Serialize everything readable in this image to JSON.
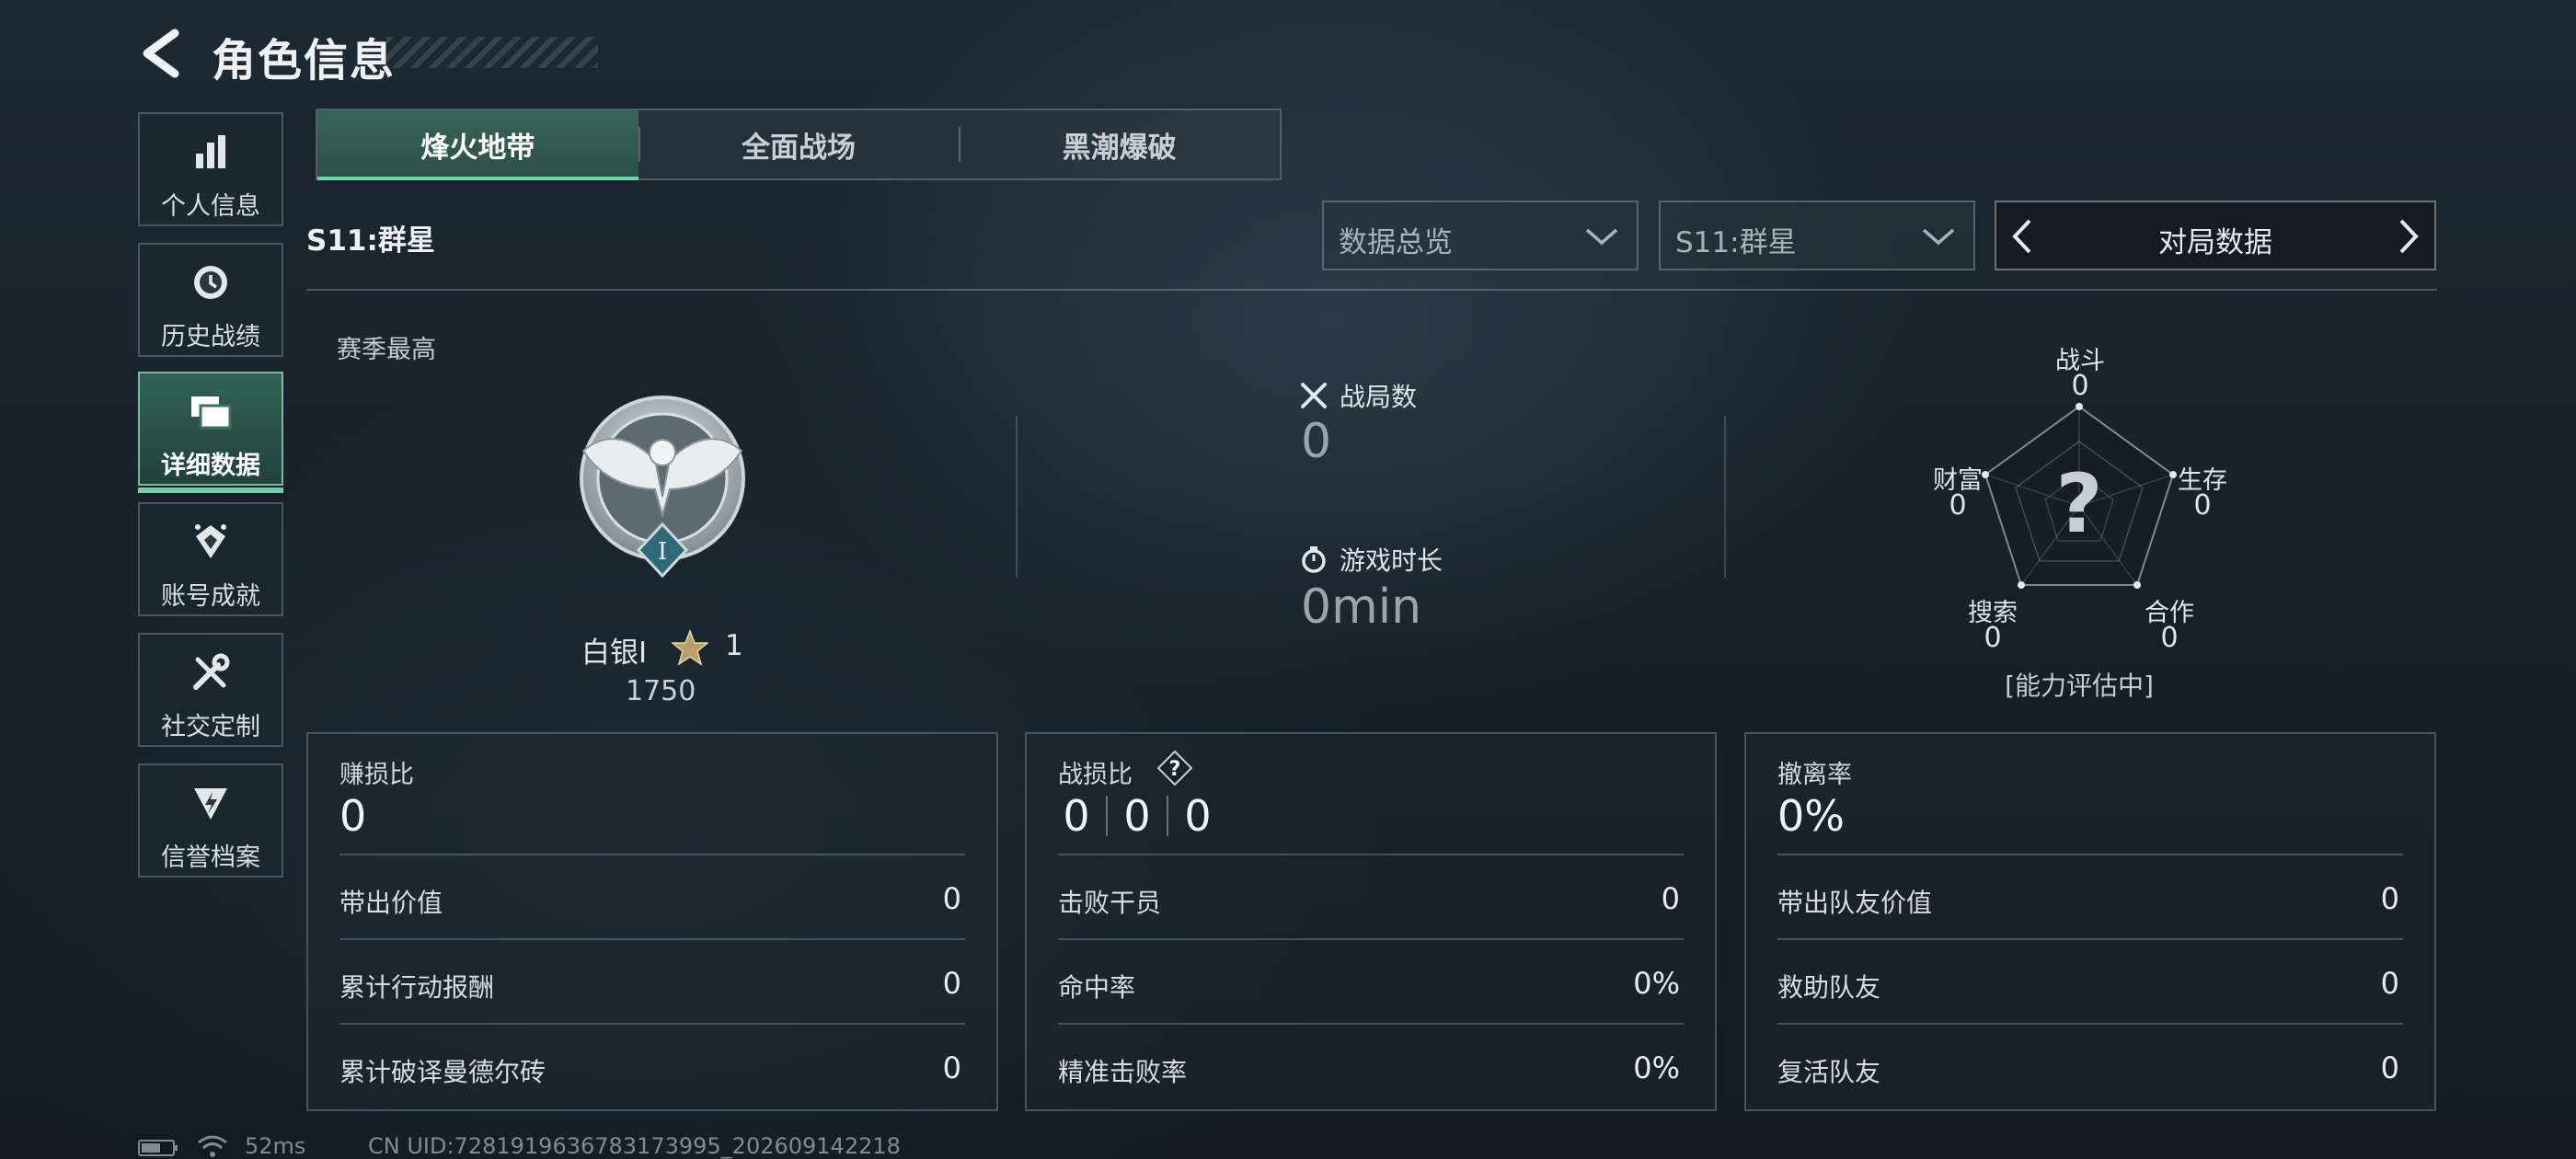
{
  "header": {
    "title": "角色信息"
  },
  "sidebar": {
    "items": [
      {
        "label": "个人信息",
        "icon": "bar-chart-icon"
      },
      {
        "label": "历史战绩",
        "icon": "history-clock-icon"
      },
      {
        "label": "详细数据",
        "icon": "folder-stack-icon",
        "active": true
      },
      {
        "label": "账号成就",
        "icon": "achievement-icon"
      },
      {
        "label": "社交定制",
        "icon": "tools-icon"
      },
      {
        "label": "信誉档案",
        "icon": "shield-bolt-icon"
      }
    ]
  },
  "tabs": [
    {
      "label": "烽火地带",
      "active": true
    },
    {
      "label": "全面战场"
    },
    {
      "label": "黑潮爆破"
    }
  ],
  "season_label": "S11:群星",
  "filters": {
    "data_type": "数据总览",
    "season": "S11:群星",
    "pager_label": "对局数据"
  },
  "rank": {
    "section_title": "赛季最高",
    "name": "白银I",
    "stars": "1",
    "score": "1750",
    "tier_mark": "I"
  },
  "stats": {
    "matches_label": "战局数",
    "matches_value": "0",
    "time_label": "游戏时长",
    "time_value": "0min"
  },
  "radar": {
    "axes": [
      {
        "label": "战斗",
        "value": "0"
      },
      {
        "label": "生存",
        "value": "0"
      },
      {
        "label": "合作",
        "value": "0"
      },
      {
        "label": "搜索",
        "value": "0"
      },
      {
        "label": "财富",
        "value": "0"
      }
    ],
    "center_mark": "?",
    "note": "[能力评估中]"
  },
  "cards": [
    {
      "title": "赚损比",
      "value": "0",
      "rows": [
        {
          "label": "带出价值",
          "value": "0"
        },
        {
          "label": "累计行动报酬",
          "value": "0"
        },
        {
          "label": "累计破译曼德尔砖",
          "value": "0"
        }
      ]
    },
    {
      "title": "战损比",
      "badge": "?",
      "values": [
        "0",
        "0",
        "0"
      ],
      "rows": [
        {
          "label": "击败干员",
          "value": "0"
        },
        {
          "label": "命中率",
          "value": "0%"
        },
        {
          "label": "精准击败率",
          "value": "0%"
        }
      ]
    },
    {
      "title": "撤离率",
      "value": "0%",
      "rows": [
        {
          "label": "带出队友价值",
          "value": "0"
        },
        {
          "label": "救助队友",
          "value": "0"
        },
        {
          "label": "复活队友",
          "value": "0"
        }
      ]
    }
  ],
  "footer": {
    "ping": "52ms",
    "uid": "CN UID:7281919636783173995_202609142218"
  },
  "colors": {
    "accent": "#6fd3a8",
    "background": "#172129"
  }
}
